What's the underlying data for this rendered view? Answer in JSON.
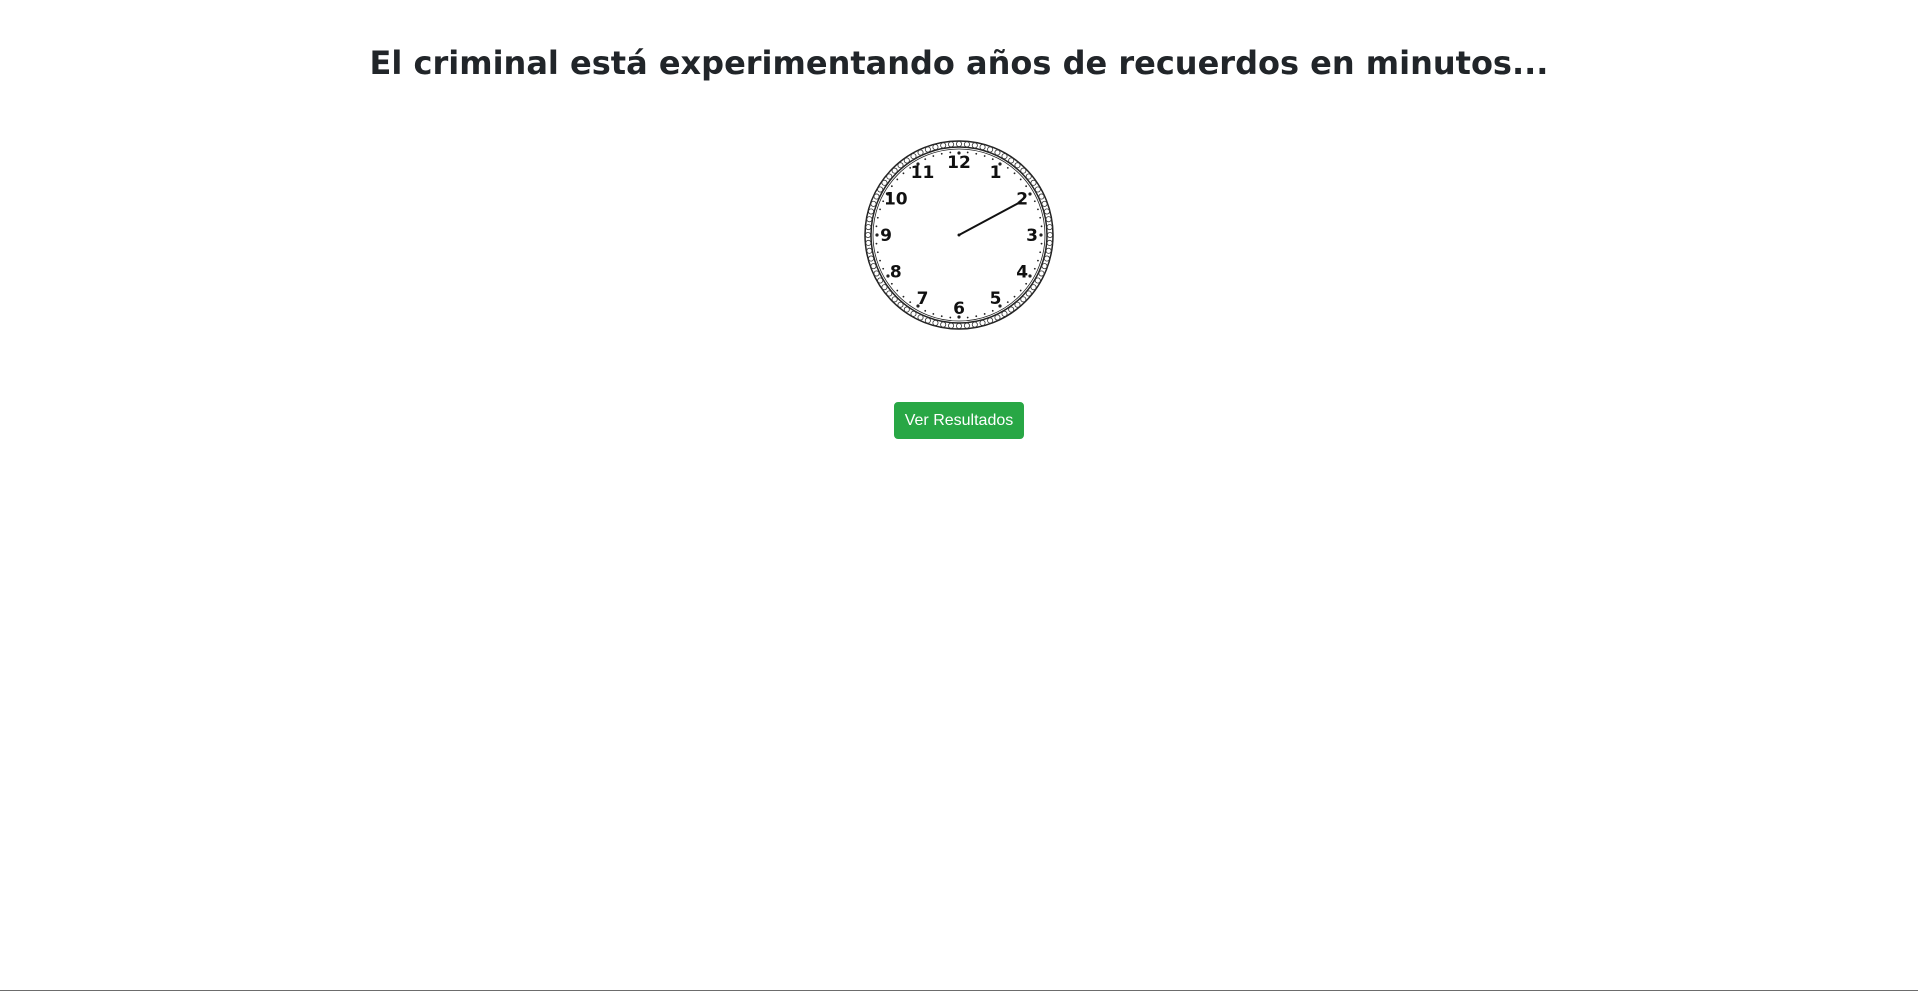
{
  "header": {
    "title": "El criminal está experimentando años de recuerdos en minutos..."
  },
  "clock": {
    "numbers": [
      "12",
      "1",
      "2",
      "3",
      "4",
      "5",
      "6",
      "7",
      "8",
      "9",
      "10",
      "11"
    ],
    "hand_minutes": 10.3
  },
  "actions": {
    "results_label": "Ver Resultados"
  },
  "colors": {
    "button_bg": "#28a745",
    "title_text": "#212529"
  }
}
